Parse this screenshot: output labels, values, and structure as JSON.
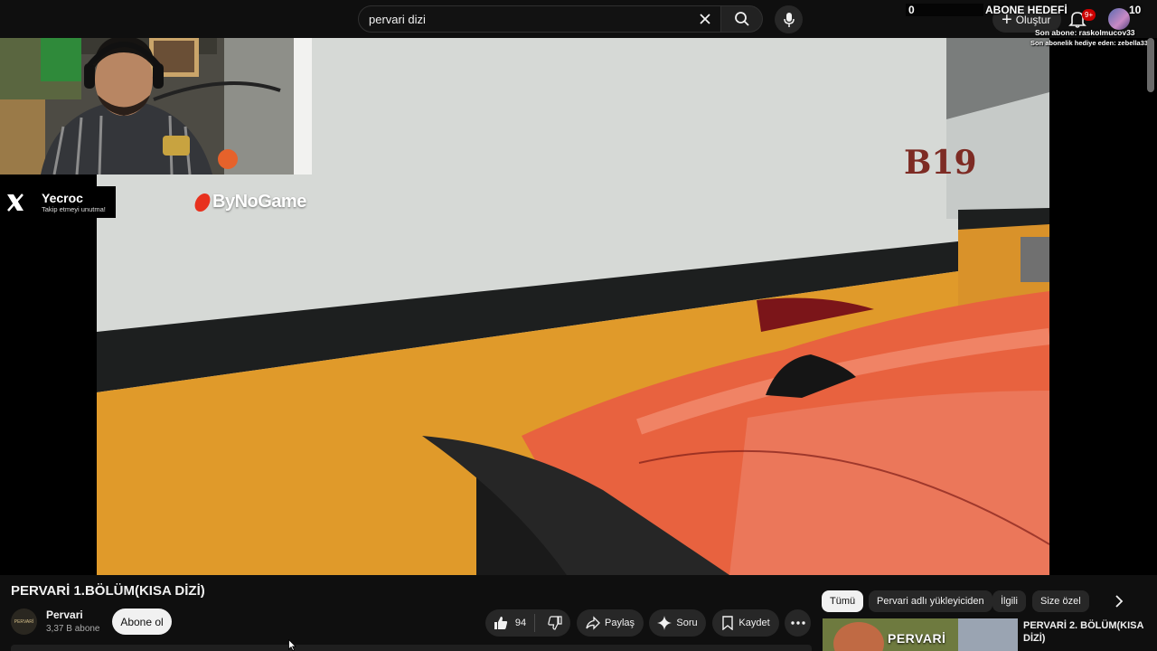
{
  "search": {
    "query": "pervari dizi"
  },
  "header": {
    "create_label": "Oluştur",
    "notification_badge": "9+"
  },
  "stream_overlay": {
    "counter": "0",
    "goal_label": "ABONE HEDEFİ",
    "goal_value": "10",
    "last_sub": "Son abone: raskolmucov33",
    "last_gift": "Son abonelik hediye eden: zebella33",
    "x_handle": "Yecroc",
    "x_subtitle": "Takip etmeyi unutma!",
    "sponsor": "ByNoGame"
  },
  "video_frame": {
    "sign_text": "B19"
  },
  "video": {
    "title": "PERVARİ 1.BÖLÜM(KISA DİZİ)",
    "channel_name": "Pervari",
    "channel_avatar_text": "PERVARİ",
    "subscribers": "3,37 B abone",
    "subscribe_label": "Abone ol",
    "like_count": "94",
    "share_label": "Paylaş",
    "ask_label": "Soru",
    "save_label": "Kaydet"
  },
  "chips": [
    "Tümü",
    "Pervari adlı yükleyiciden",
    "İlgili",
    "Size özel"
  ],
  "recommendation": {
    "thumb_text": "PERVARİ",
    "title": "PERVARİ 2. BÖLÜM(KISA DİZİ)"
  },
  "colors": {
    "accent": "#cc0000",
    "car_orange": "#e8623f",
    "wall_yellow": "#e09a2a"
  }
}
